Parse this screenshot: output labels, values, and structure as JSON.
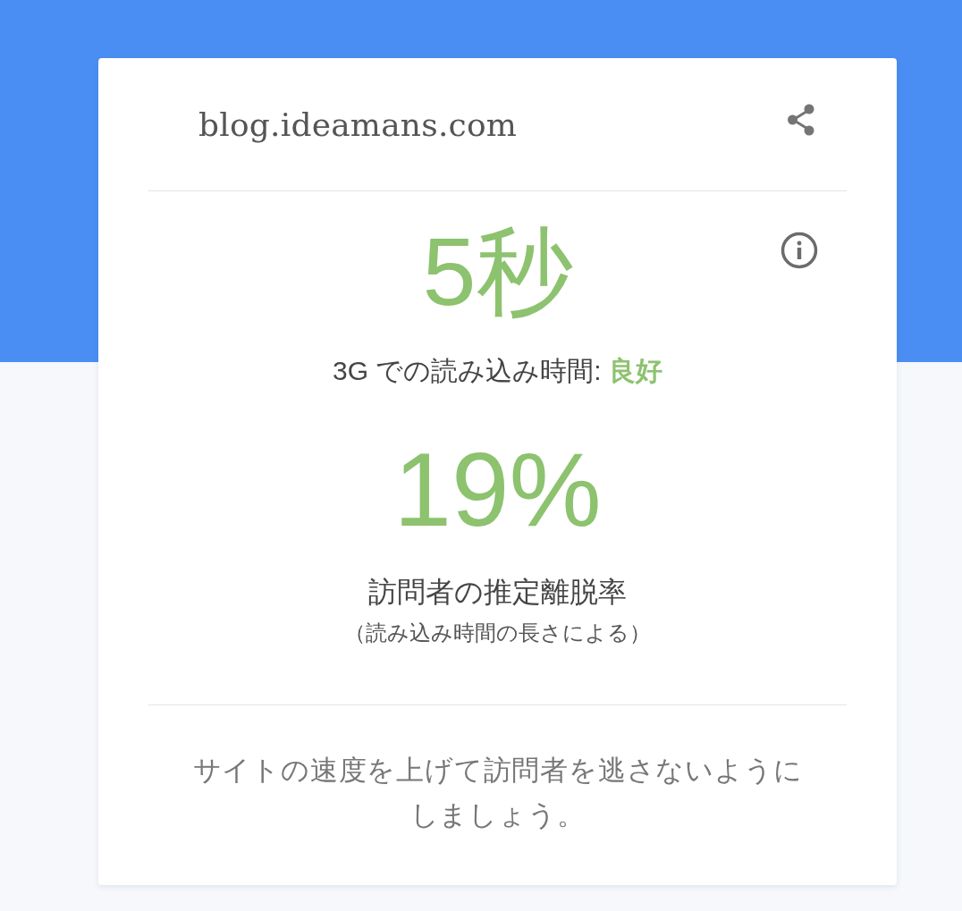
{
  "site": {
    "domain": "blog.ideamans.com"
  },
  "load_time": {
    "value": "5秒",
    "caption": "3G での読み込み時間: **良好**"
  },
  "bounce": {
    "value": "19%",
    "title": "訪問者の推定離脱率",
    "note": "（読み込み時間の長さによる）"
  },
  "footer": {
    "message": "サイトの速度を上げて訪問者を逃さないようにしましょう。"
  }
}
